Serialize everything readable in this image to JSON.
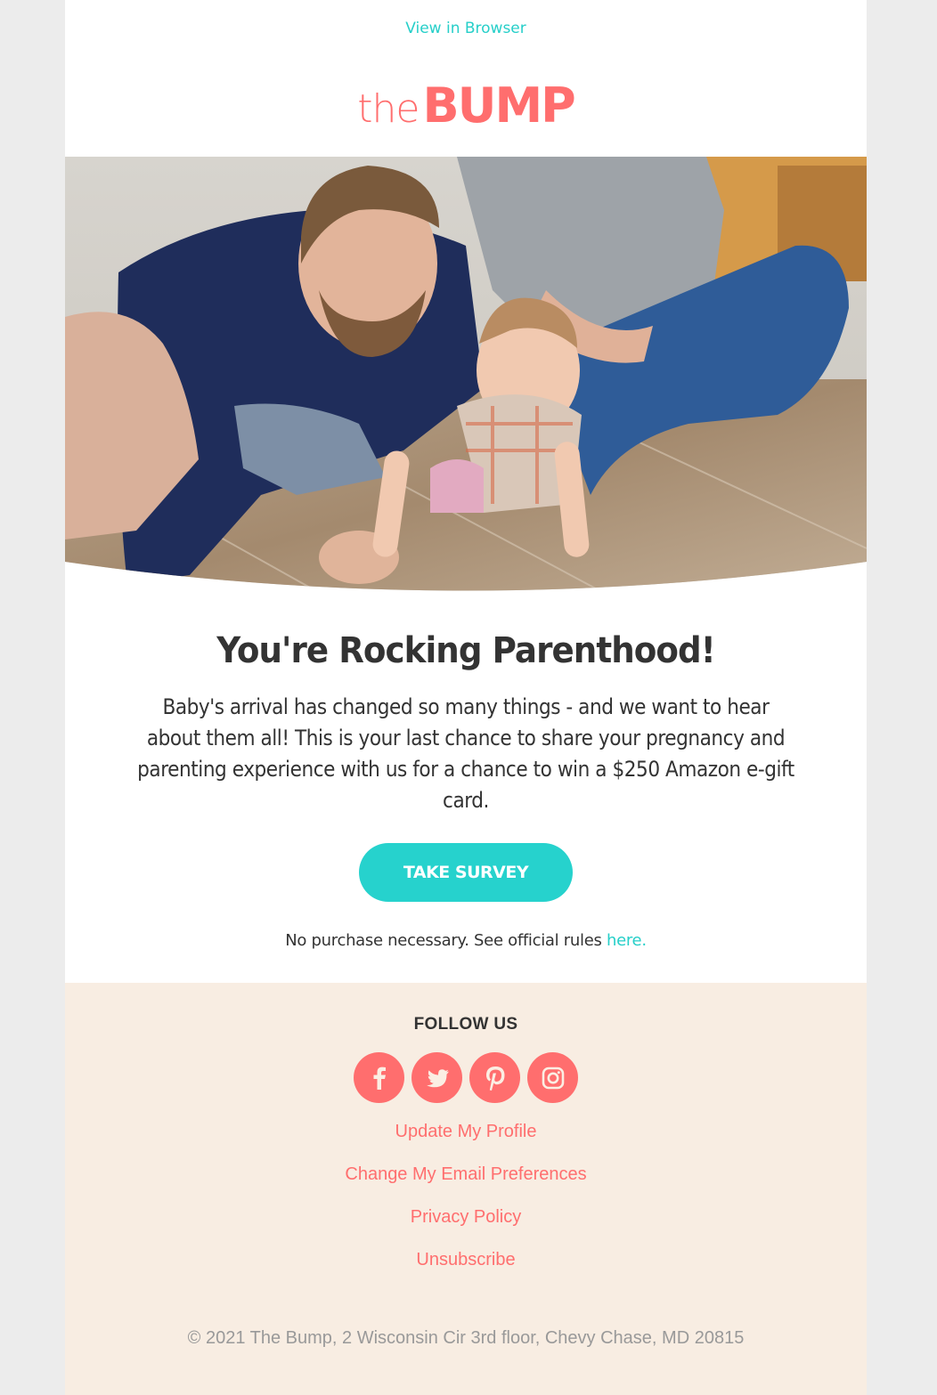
{
  "header": {
    "view_in_browser": "View in Browser",
    "logo": {
      "the": "the",
      "bump": "BUMP"
    }
  },
  "hero": {
    "alt": "Smiling father and crawling baby on a wooden floor with mother sitting behind"
  },
  "main": {
    "headline": "You're Rocking Parenthood!",
    "body": "Baby's arrival has changed so many things - and we want to hear about them all! This is your last chance to share your pregnancy and parenting experience with us for a chance to win a $250 Amazon e-gift card.",
    "cta_label": "TAKE SURVEY",
    "disclaimer": "No purchase necessary. See official rules ",
    "disclaimer_link": "here."
  },
  "footer": {
    "follow_label": "FOLLOW US",
    "socials": [
      {
        "name": "facebook",
        "icon": "facebook-icon"
      },
      {
        "name": "twitter",
        "icon": "twitter-icon"
      },
      {
        "name": "pinterest",
        "icon": "pinterest-icon"
      },
      {
        "name": "instagram",
        "icon": "instagram-icon"
      }
    ],
    "links": [
      "Update My Profile",
      "Change My Email Preferences",
      "Privacy Policy",
      "Unsubscribe"
    ],
    "copyright": "© 2021 The Bump, 2 Wisconsin Cir 3rd floor, Chevy Chase, MD 20815"
  },
  "colors": {
    "accent_teal": "#26d2cd",
    "brand_coral": "#ff6e6e",
    "footer_bg": "#f8ede2",
    "page_bg": "#ececec",
    "text_dark": "#333333",
    "text_muted": "#999999"
  }
}
